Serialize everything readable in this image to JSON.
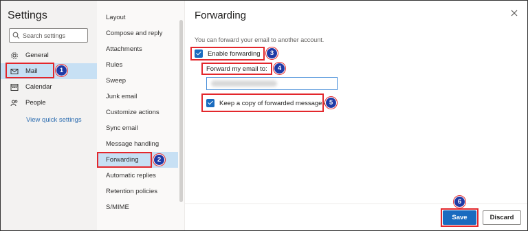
{
  "left": {
    "title": "Settings",
    "search_placeholder": "Search settings",
    "categories": [
      {
        "label": "General",
        "icon": "gear-icon"
      },
      {
        "label": "Mail",
        "icon": "mail-icon"
      },
      {
        "label": "Calendar",
        "icon": "calendar-icon"
      },
      {
        "label": "People",
        "icon": "people-icon"
      }
    ],
    "view_quick_settings": "View quick settings"
  },
  "mid": {
    "items": [
      "Layout",
      "Compose and reply",
      "Attachments",
      "Rules",
      "Sweep",
      "Junk email",
      "Customize actions",
      "Sync email",
      "Message handling",
      "Forwarding",
      "Automatic replies",
      "Retention policies",
      "S/MIME"
    ]
  },
  "right": {
    "heading": "Forwarding",
    "description": "You can forward your email to another account.",
    "enable_forwarding": "Enable forwarding",
    "forward_to_label": "Forward my email to:",
    "keep_copy": "Keep a copy of forwarded messages"
  },
  "footer": {
    "save": "Save",
    "discard": "Discard"
  },
  "annotations": {
    "badges": [
      "1",
      "2",
      "3",
      "4",
      "5",
      "6"
    ]
  },
  "colors": {
    "accent": "#1a6bbf",
    "highlight": "#c7e0f4",
    "annotation_box": "#e3272c",
    "badge": "#1f3aa6"
  }
}
